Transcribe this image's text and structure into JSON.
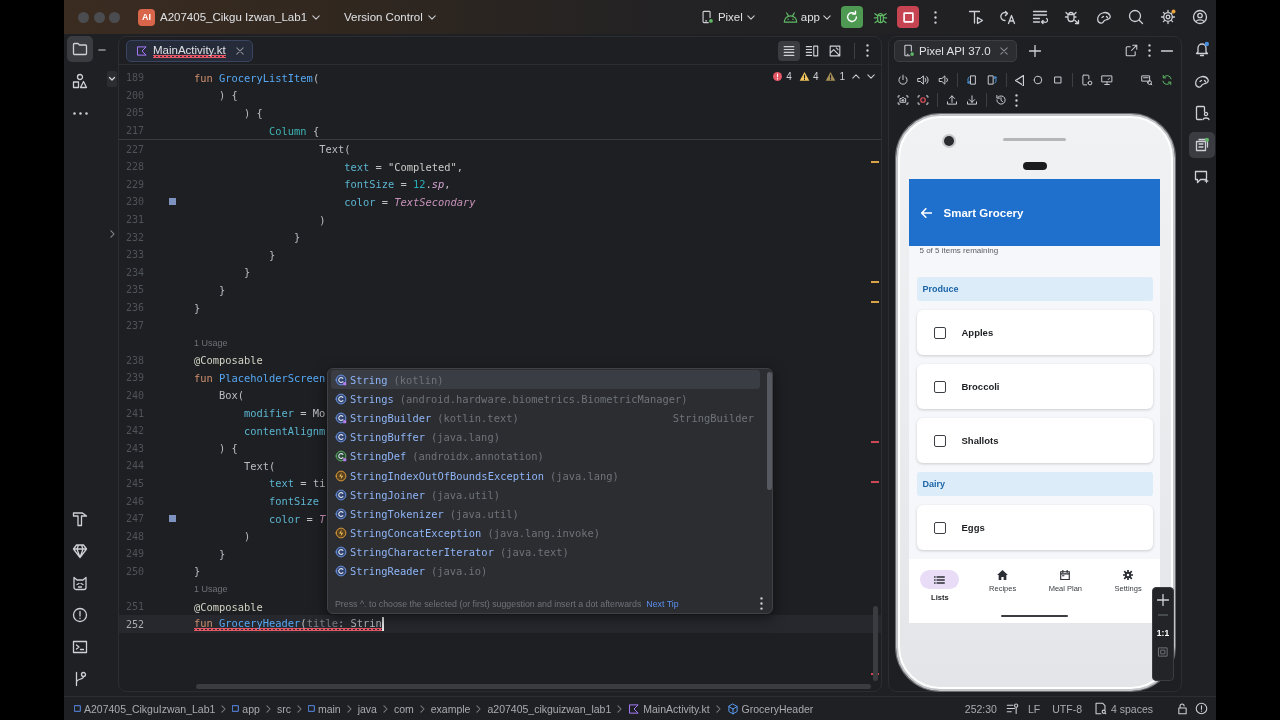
{
  "title_bar": {
    "badge": "AI",
    "project": "A207405_Cikgu Izwan_Lab1",
    "vcs": "Version Control",
    "device": "Pixel",
    "run_config": "app"
  },
  "left_toolbar": {
    "top": [
      {
        "selected": true
      },
      {
        "selected": false
      },
      {
        "selected": false
      }
    ],
    "bottom": [
      {
        "selected": false
      },
      {
        "selected": false
      },
      {
        "selected": false
      },
      {
        "selected": false
      },
      {
        "selected": false
      },
      {
        "selected": false
      }
    ]
  },
  "editor": {
    "tabs": [
      {
        "label": "MainActivity.kt",
        "selected": true,
        "error": true
      }
    ],
    "view_modes": [
      {
        "selected": true
      },
      {
        "selected": false
      },
      {
        "selected": false
      }
    ],
    "inspections": [
      {
        "kind": "error",
        "count": "4"
      },
      {
        "kind": "warning",
        "count": "4"
      },
      {
        "kind": "weak-warning",
        "count": "1"
      }
    ],
    "sticky_lines": [
      {
        "kind": "code",
        "number": "189",
        "tokens": [
          {
            "kind": "keyword",
            "text": "fun "
          },
          {
            "kind": "decl",
            "text": "GroceryListItem"
          },
          {
            "kind": "plain",
            "text": "("
          }
        ],
        "current": false,
        "error": false,
        "swatch": false
      },
      {
        "kind": "code",
        "number": "200",
        "tokens": [
          {
            "kind": "plain",
            "text": "    ) {"
          }
        ],
        "current": false,
        "error": false,
        "swatch": false
      },
      {
        "kind": "code",
        "number": "205",
        "tokens": [
          {
            "kind": "plain",
            "text": "        ) {"
          }
        ],
        "current": false,
        "error": false,
        "swatch": false
      },
      {
        "kind": "code",
        "number": "217",
        "tokens": [
          {
            "kind": "call",
            "text": "            Column"
          },
          {
            "kind": "plain",
            "text": " {"
          }
        ],
        "current": false,
        "error": false,
        "swatch": false
      }
    ],
    "lines": [
      {
        "kind": "code",
        "number": "227",
        "tokens": [
          {
            "kind": "plain",
            "text": "                    Text("
          }
        ],
        "current": false,
        "error": false,
        "swatch": false
      },
      {
        "kind": "code",
        "number": "228",
        "tokens": [
          {
            "kind": "arg",
            "text": "                        text"
          },
          {
            "kind": "plain",
            "text": " = "
          },
          {
            "kind": "string",
            "text": "\"Completed\""
          },
          {
            "kind": "plain",
            "text": ","
          }
        ],
        "current": false,
        "error": false,
        "swatch": false
      },
      {
        "kind": "code",
        "number": "229",
        "tokens": [
          {
            "kind": "arg",
            "text": "                        fontSize"
          },
          {
            "kind": "plain",
            "text": " = "
          },
          {
            "kind": "number",
            "text": "12"
          },
          {
            "kind": "plain",
            "text": "."
          },
          {
            "kind": "ext",
            "text": "sp"
          },
          {
            "kind": "plain",
            "text": ","
          }
        ],
        "current": false,
        "error": false,
        "swatch": false
      },
      {
        "kind": "code",
        "number": "230",
        "tokens": [
          {
            "kind": "arg",
            "text": "                        color"
          },
          {
            "kind": "plain",
            "text": " = "
          },
          {
            "kind": "prop",
            "text": "TextSecondary"
          }
        ],
        "current": false,
        "error": false,
        "swatch": true
      },
      {
        "kind": "code",
        "number": "231",
        "tokens": [
          {
            "kind": "plain",
            "text": "                    )"
          }
        ],
        "current": false,
        "error": false,
        "swatch": false
      },
      {
        "kind": "code",
        "number": "232",
        "tokens": [
          {
            "kind": "plain",
            "text": "                }"
          }
        ],
        "current": false,
        "error": false,
        "swatch": false
      },
      {
        "kind": "code",
        "number": "233",
        "tokens": [
          {
            "kind": "plain",
            "text": "            }"
          }
        ],
        "current": false,
        "error": false,
        "swatch": false
      },
      {
        "kind": "code",
        "number": "234",
        "tokens": [
          {
            "kind": "plain",
            "text": "        }"
          }
        ],
        "current": false,
        "error": false,
        "swatch": false
      },
      {
        "kind": "code",
        "number": "235",
        "tokens": [
          {
            "kind": "plain",
            "text": "    }"
          }
        ],
        "current": false,
        "error": false,
        "swatch": false
      },
      {
        "kind": "code",
        "number": "236",
        "tokens": [
          {
            "kind": "plain",
            "text": "}"
          }
        ],
        "current": false,
        "error": false,
        "swatch": false
      },
      {
        "kind": "code",
        "number": "237",
        "current": false
      },
      {
        "kind": "usage",
        "text": "1 Usage"
      },
      {
        "kind": "code",
        "number": "238",
        "tokens": [
          {
            "kind": "annotation",
            "text": "@Composable"
          }
        ],
        "current": false,
        "error": false,
        "swatch": false
      },
      {
        "kind": "code",
        "number": "239",
        "tokens": [
          {
            "kind": "keyword",
            "text": "fun "
          },
          {
            "kind": "decl",
            "text": "PlaceholderScreen"
          }
        ],
        "current": false,
        "error": false,
        "swatch": false
      },
      {
        "kind": "code",
        "number": "240",
        "tokens": [
          {
            "kind": "plain",
            "text": "    Box("
          }
        ],
        "current": false,
        "error": false,
        "swatch": false
      },
      {
        "kind": "code",
        "number": "241",
        "tokens": [
          {
            "kind": "arg",
            "text": "        modifier"
          },
          {
            "kind": "plain",
            "text": " = Mo"
          }
        ],
        "current": false,
        "error": false,
        "swatch": false
      },
      {
        "kind": "code",
        "number": "242",
        "tokens": [
          {
            "kind": "arg",
            "text": "        contentAlignm"
          }
        ],
        "current": false,
        "error": false,
        "swatch": false
      },
      {
        "kind": "code",
        "number": "243",
        "tokens": [
          {
            "kind": "plain",
            "text": "    ) {"
          }
        ],
        "current": false,
        "error": false,
        "swatch": false
      },
      {
        "kind": "code",
        "number": "244",
        "tokens": [
          {
            "kind": "plain",
            "text": "        Text("
          }
        ],
        "current": false,
        "error": false,
        "swatch": false
      },
      {
        "kind": "code",
        "number": "245",
        "tokens": [
          {
            "kind": "arg",
            "text": "            text"
          },
          {
            "kind": "plain",
            "text": " = ti"
          }
        ],
        "current": false,
        "error": false,
        "swatch": false
      },
      {
        "kind": "code",
        "number": "246",
        "tokens": [
          {
            "kind": "arg",
            "text": "            fontSize"
          }
        ],
        "current": false,
        "error": false,
        "swatch": false
      },
      {
        "kind": "code",
        "number": "247",
        "tokens": [
          {
            "kind": "arg",
            "text": "            color"
          },
          {
            "kind": "plain",
            "text": " = "
          },
          {
            "kind": "prop",
            "text": "T"
          }
        ],
        "current": false,
        "error": false,
        "swatch": true
      },
      {
        "kind": "code",
        "number": "248",
        "tokens": [
          {
            "kind": "plain",
            "text": "        )"
          }
        ],
        "current": false,
        "error": false,
        "swatch": false
      },
      {
        "kind": "code",
        "number": "249",
        "tokens": [
          {
            "kind": "plain",
            "text": "    }"
          }
        ],
        "current": false,
        "error": false,
        "swatch": false
      },
      {
        "kind": "code",
        "number": "250",
        "tokens": [
          {
            "kind": "plain",
            "text": "}"
          }
        ],
        "current": false,
        "error": false,
        "swatch": false
      },
      {
        "kind": "usage",
        "text": "1 Usage"
      },
      {
        "kind": "code",
        "number": "251",
        "tokens": [
          {
            "kind": "annotation",
            "text": "@Composable"
          }
        ],
        "current": false,
        "error": false,
        "swatch": false
      },
      {
        "kind": "code",
        "number": "252",
        "tokens": [
          {
            "kind": "keyword",
            "text": "fun "
          },
          {
            "kind": "decl",
            "text": "GroceryHeader"
          },
          {
            "kind": "plain",
            "text": "("
          },
          {
            "kind": "param",
            "text": "title"
          },
          {
            "kind": "plain",
            "text": ": Strin"
          }
        ],
        "current": true,
        "error": true,
        "swatch": false
      }
    ],
    "completion": {
      "items": [
        {
          "kind": "kotlin-class",
          "name": "String",
          "detail": "(kotlin)",
          "selected": true
        },
        {
          "kind": "class",
          "name": "Strings",
          "detail": "(android.hardware.biometrics.BiometricManager)",
          "selected": false
        },
        {
          "kind": "kotlin-class",
          "name": "StringBuilder",
          "detail": "(kotlin.text)",
          "type": "StringBuilder",
          "selected": false
        },
        {
          "kind": "class",
          "name": "StringBuffer",
          "detail": "(java.lang)",
          "selected": false
        },
        {
          "kind": "annotation",
          "name": "StringDef",
          "detail": "(androidx.annotation)",
          "selected": false
        },
        {
          "kind": "exception",
          "name": "StringIndexOutOfBoundsException",
          "detail": "(java.lang)",
          "selected": false
        },
        {
          "kind": "class",
          "name": "StringJoiner",
          "detail": "(java.util)",
          "selected": false
        },
        {
          "kind": "class",
          "name": "StringTokenizer",
          "detail": "(java.util)",
          "selected": false
        },
        {
          "kind": "exception",
          "name": "StringConcatException",
          "detail": "(java.lang.invoke)",
          "selected": false
        },
        {
          "kind": "class",
          "name": "StringCharacterIterator",
          "detail": "(java.text)",
          "selected": false
        },
        {
          "kind": "class",
          "name": "StringReader",
          "detail": "(java.io)",
          "selected": false
        }
      ],
      "hint": "Press ^. to choose the selected (or first) suggestion and insert a dot afterwards",
      "link": "Next Tip"
    }
  },
  "emulator": {
    "tabs": [
      {
        "label": "Pixel API 37.0",
        "selected": true
      }
    ],
    "app": {
      "title": "Smart Grocery",
      "summary": "5 of 5 items remaining",
      "sections": [
        {
          "title": "Produce",
          "items": [
            {
              "name": "Apples",
              "checked": false
            },
            {
              "name": "Broccoli",
              "checked": false
            },
            {
              "name": "Shallots",
              "checked": false
            }
          ]
        },
        {
          "title": "Dairy",
          "items": [
            {
              "name": "Eggs",
              "checked": false
            }
          ]
        }
      ],
      "nav": [
        {
          "label": "Lists",
          "selected": true
        },
        {
          "label": "Recipes",
          "selected": false
        },
        {
          "label": "Meal Plan",
          "selected": false
        },
        {
          "label": "Settings",
          "selected": false
        }
      ]
    },
    "zoom_label": "1:1"
  },
  "right_toolbar": [
    {
      "selected": false
    },
    {
      "selected": false
    },
    {
      "selected": false
    },
    {
      "selected": true
    },
    {
      "selected": false
    }
  ],
  "status_bar": {
    "breadcrumbs": [
      {
        "kind": "module",
        "label": "A207405_CikguIzwan_Lab1"
      },
      {
        "kind": "module",
        "label": "app"
      },
      {
        "kind": "plain",
        "label": "src"
      },
      {
        "kind": "module",
        "label": "main"
      },
      {
        "kind": "plain",
        "label": "java"
      },
      {
        "kind": "plain",
        "label": "com"
      },
      {
        "kind": "plain",
        "label": "example"
      },
      {
        "kind": "plain",
        "label": "a207405_cikguizwan_lab1"
      },
      {
        "kind": "kotlin-file",
        "label": "MainActivity.kt"
      },
      {
        "kind": "function",
        "label": "GroceryHeader"
      }
    ],
    "position": "252:30",
    "line_separator": "LF",
    "encoding": "UTF-8",
    "indent": "4 spaces"
  }
}
